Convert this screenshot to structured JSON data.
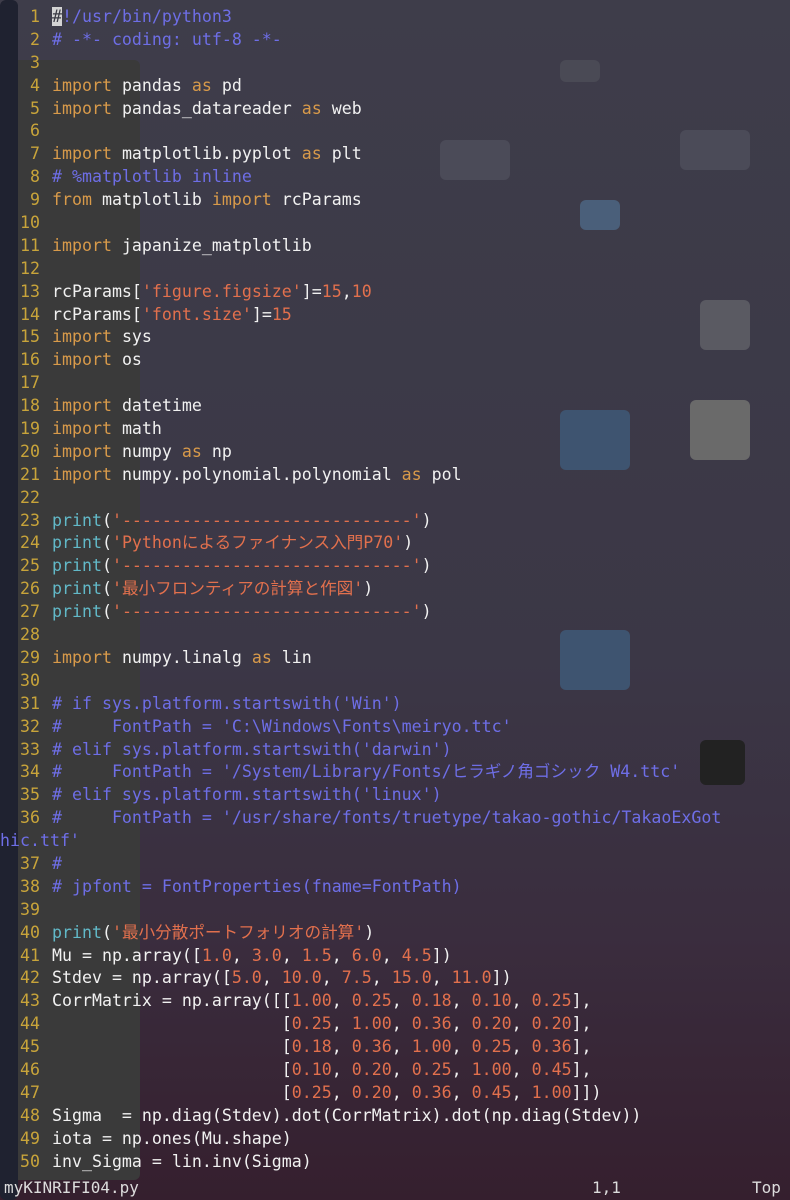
{
  "lines": [
    {
      "n": "1",
      "segs": [
        {
          "t": "#",
          "c": "cur"
        },
        {
          "t": "!/usr/bin/python3",
          "c": "c"
        }
      ]
    },
    {
      "n": "2",
      "segs": [
        {
          "t": "# -*- coding: utf-8 -*-",
          "c": "c"
        }
      ]
    },
    {
      "n": "3",
      "segs": []
    },
    {
      "n": "4",
      "segs": [
        {
          "t": "import",
          "c": "k"
        },
        {
          "t": " pandas ",
          "c": "t"
        },
        {
          "t": "as",
          "c": "k"
        },
        {
          "t": " pd",
          "c": "t"
        }
      ]
    },
    {
      "n": "5",
      "segs": [
        {
          "t": "import",
          "c": "k"
        },
        {
          "t": " pandas_datareader ",
          "c": "t"
        },
        {
          "t": "as",
          "c": "k"
        },
        {
          "t": " web",
          "c": "t"
        }
      ]
    },
    {
      "n": "6",
      "segs": []
    },
    {
      "n": "7",
      "segs": [
        {
          "t": "import",
          "c": "k"
        },
        {
          "t": " matplotlib.pyplot ",
          "c": "t"
        },
        {
          "t": "as",
          "c": "k"
        },
        {
          "t": " plt",
          "c": "t"
        }
      ]
    },
    {
      "n": "8",
      "segs": [
        {
          "t": "# %matplotlib inline",
          "c": "c"
        }
      ]
    },
    {
      "n": "9",
      "segs": [
        {
          "t": "from",
          "c": "k"
        },
        {
          "t": " matplotlib ",
          "c": "t"
        },
        {
          "t": "import",
          "c": "k"
        },
        {
          "t": " rcParams",
          "c": "t"
        }
      ]
    },
    {
      "n": "10",
      "segs": []
    },
    {
      "n": "11",
      "segs": [
        {
          "t": "import",
          "c": "k"
        },
        {
          "t": " japanize_matplotlib",
          "c": "t"
        }
      ]
    },
    {
      "n": "12",
      "segs": []
    },
    {
      "n": "13",
      "segs": [
        {
          "t": "rcParams[",
          "c": "t"
        },
        {
          "t": "'figure.figsize'",
          "c": "s"
        },
        {
          "t": "]=",
          "c": "t"
        },
        {
          "t": "15",
          "c": "n"
        },
        {
          "t": ",",
          "c": "t"
        },
        {
          "t": "10",
          "c": "n"
        }
      ]
    },
    {
      "n": "14",
      "segs": [
        {
          "t": "rcParams[",
          "c": "t"
        },
        {
          "t": "'font.size'",
          "c": "s"
        },
        {
          "t": "]=",
          "c": "t"
        },
        {
          "t": "15",
          "c": "n"
        }
      ]
    },
    {
      "n": "15",
      "segs": [
        {
          "t": "import",
          "c": "k"
        },
        {
          "t": " sys",
          "c": "t"
        }
      ]
    },
    {
      "n": "16",
      "segs": [
        {
          "t": "import",
          "c": "k"
        },
        {
          "t": " os",
          "c": "t"
        }
      ]
    },
    {
      "n": "17",
      "segs": []
    },
    {
      "n": "18",
      "segs": [
        {
          "t": "import",
          "c": "k"
        },
        {
          "t": " datetime",
          "c": "t"
        }
      ]
    },
    {
      "n": "19",
      "segs": [
        {
          "t": "import",
          "c": "k"
        },
        {
          "t": " math",
          "c": "t"
        }
      ]
    },
    {
      "n": "20",
      "segs": [
        {
          "t": "import",
          "c": "k"
        },
        {
          "t": " numpy ",
          "c": "t"
        },
        {
          "t": "as",
          "c": "k"
        },
        {
          "t": " np",
          "c": "t"
        }
      ]
    },
    {
      "n": "21",
      "segs": [
        {
          "t": "import",
          "c": "k"
        },
        {
          "t": " numpy.polynomial.polynomial ",
          "c": "t"
        },
        {
          "t": "as",
          "c": "k"
        },
        {
          "t": " pol",
          "c": "t"
        }
      ]
    },
    {
      "n": "22",
      "segs": []
    },
    {
      "n": "23",
      "segs": [
        {
          "t": "print",
          "c": "f"
        },
        {
          "t": "(",
          "c": "t"
        },
        {
          "t": "'-----------------------------'",
          "c": "s"
        },
        {
          "t": ")",
          "c": "t"
        }
      ]
    },
    {
      "n": "24",
      "segs": [
        {
          "t": "print",
          "c": "f"
        },
        {
          "t": "(",
          "c": "t"
        },
        {
          "t": "'Pythonによるファイナンス入門P70'",
          "c": "s"
        },
        {
          "t": ")",
          "c": "t"
        }
      ]
    },
    {
      "n": "25",
      "segs": [
        {
          "t": "print",
          "c": "f"
        },
        {
          "t": "(",
          "c": "t"
        },
        {
          "t": "'-----------------------------'",
          "c": "s"
        },
        {
          "t": ")",
          "c": "t"
        }
      ]
    },
    {
      "n": "26",
      "segs": [
        {
          "t": "print",
          "c": "f"
        },
        {
          "t": "(",
          "c": "t"
        },
        {
          "t": "'最小フロンティアの計算と作図'",
          "c": "s"
        },
        {
          "t": ")",
          "c": "t"
        }
      ]
    },
    {
      "n": "27",
      "segs": [
        {
          "t": "print",
          "c": "f"
        },
        {
          "t": "(",
          "c": "t"
        },
        {
          "t": "'-----------------------------'",
          "c": "s"
        },
        {
          "t": ")",
          "c": "t"
        }
      ]
    },
    {
      "n": "28",
      "segs": []
    },
    {
      "n": "29",
      "segs": [
        {
          "t": "import",
          "c": "k"
        },
        {
          "t": " numpy.linalg ",
          "c": "t"
        },
        {
          "t": "as",
          "c": "k"
        },
        {
          "t": " lin",
          "c": "t"
        }
      ]
    },
    {
      "n": "30",
      "segs": []
    },
    {
      "n": "31",
      "segs": [
        {
          "t": "# if sys.platform.startswith('Win')",
          "c": "c"
        }
      ]
    },
    {
      "n": "32",
      "segs": [
        {
          "t": "#     FontPath = 'C:\\Windows\\Fonts\\meiryo.ttc'",
          "c": "c"
        }
      ]
    },
    {
      "n": "33",
      "segs": [
        {
          "t": "# elif sys.platform.startswith('darwin')",
          "c": "c"
        }
      ]
    },
    {
      "n": "34",
      "segs": [
        {
          "t": "#     FontPath = '/System/Library/Fonts/ヒラギノ角ゴシック W4.ttc'",
          "c": "c"
        }
      ]
    },
    {
      "n": "35",
      "segs": [
        {
          "t": "# elif sys.platform.startswith('linux')",
          "c": "c"
        }
      ]
    },
    {
      "n": "36",
      "segs": [
        {
          "t": "#     FontPath = '/usr/share/fonts/truetype/takao-gothic/TakaoExGot",
          "c": "c"
        }
      ]
    },
    {
      "n": "",
      "cont": true,
      "segs": [
        {
          "t": "hic.ttf'",
          "c": "c"
        }
      ]
    },
    {
      "n": "37",
      "segs": [
        {
          "t": "#",
          "c": "c"
        }
      ]
    },
    {
      "n": "38",
      "segs": [
        {
          "t": "# jpfont = FontProperties(fname=FontPath)",
          "c": "c"
        }
      ]
    },
    {
      "n": "39",
      "segs": []
    },
    {
      "n": "40",
      "segs": [
        {
          "t": "print",
          "c": "f"
        },
        {
          "t": "(",
          "c": "t"
        },
        {
          "t": "'最小分散ポートフォリオの計算'",
          "c": "s"
        },
        {
          "t": ")",
          "c": "t"
        }
      ]
    },
    {
      "n": "41",
      "segs": [
        {
          "t": "Mu = np.array([",
          "c": "t"
        },
        {
          "t": "1.0",
          "c": "n"
        },
        {
          "t": ", ",
          "c": "t"
        },
        {
          "t": "3.0",
          "c": "n"
        },
        {
          "t": ", ",
          "c": "t"
        },
        {
          "t": "1.5",
          "c": "n"
        },
        {
          "t": ", ",
          "c": "t"
        },
        {
          "t": "6.0",
          "c": "n"
        },
        {
          "t": ", ",
          "c": "t"
        },
        {
          "t": "4.5",
          "c": "n"
        },
        {
          "t": "])",
          "c": "t"
        }
      ]
    },
    {
      "n": "42",
      "segs": [
        {
          "t": "Stdev = np.array([",
          "c": "t"
        },
        {
          "t": "5.0",
          "c": "n"
        },
        {
          "t": ", ",
          "c": "t"
        },
        {
          "t": "10.0",
          "c": "n"
        },
        {
          "t": ", ",
          "c": "t"
        },
        {
          "t": "7.5",
          "c": "n"
        },
        {
          "t": ", ",
          "c": "t"
        },
        {
          "t": "15.0",
          "c": "n"
        },
        {
          "t": ", ",
          "c": "t"
        },
        {
          "t": "11.0",
          "c": "n"
        },
        {
          "t": "])",
          "c": "t"
        }
      ]
    },
    {
      "n": "43",
      "segs": [
        {
          "t": "CorrMatrix = np.array([[",
          "c": "t"
        },
        {
          "t": "1.00",
          "c": "n"
        },
        {
          "t": ", ",
          "c": "t"
        },
        {
          "t": "0.25",
          "c": "n"
        },
        {
          "t": ", ",
          "c": "t"
        },
        {
          "t": "0.18",
          "c": "n"
        },
        {
          "t": ", ",
          "c": "t"
        },
        {
          "t": "0.10",
          "c": "n"
        },
        {
          "t": ", ",
          "c": "t"
        },
        {
          "t": "0.25",
          "c": "n"
        },
        {
          "t": "],",
          "c": "t"
        }
      ]
    },
    {
      "n": "44",
      "segs": [
        {
          "t": "                       [",
          "c": "t"
        },
        {
          "t": "0.25",
          "c": "n"
        },
        {
          "t": ", ",
          "c": "t"
        },
        {
          "t": "1.00",
          "c": "n"
        },
        {
          "t": ", ",
          "c": "t"
        },
        {
          "t": "0.36",
          "c": "n"
        },
        {
          "t": ", ",
          "c": "t"
        },
        {
          "t": "0.20",
          "c": "n"
        },
        {
          "t": ", ",
          "c": "t"
        },
        {
          "t": "0.20",
          "c": "n"
        },
        {
          "t": "],",
          "c": "t"
        }
      ]
    },
    {
      "n": "45",
      "segs": [
        {
          "t": "                       [",
          "c": "t"
        },
        {
          "t": "0.18",
          "c": "n"
        },
        {
          "t": ", ",
          "c": "t"
        },
        {
          "t": "0.36",
          "c": "n"
        },
        {
          "t": ", ",
          "c": "t"
        },
        {
          "t": "1.00",
          "c": "n"
        },
        {
          "t": ", ",
          "c": "t"
        },
        {
          "t": "0.25",
          "c": "n"
        },
        {
          "t": ", ",
          "c": "t"
        },
        {
          "t": "0.36",
          "c": "n"
        },
        {
          "t": "],",
          "c": "t"
        }
      ]
    },
    {
      "n": "46",
      "segs": [
        {
          "t": "                       [",
          "c": "t"
        },
        {
          "t": "0.10",
          "c": "n"
        },
        {
          "t": ", ",
          "c": "t"
        },
        {
          "t": "0.20",
          "c": "n"
        },
        {
          "t": ", ",
          "c": "t"
        },
        {
          "t": "0.25",
          "c": "n"
        },
        {
          "t": ", ",
          "c": "t"
        },
        {
          "t": "1.00",
          "c": "n"
        },
        {
          "t": ", ",
          "c": "t"
        },
        {
          "t": "0.45",
          "c": "n"
        },
        {
          "t": "],",
          "c": "t"
        }
      ]
    },
    {
      "n": "47",
      "segs": [
        {
          "t": "                       [",
          "c": "t"
        },
        {
          "t": "0.25",
          "c": "n"
        },
        {
          "t": ", ",
          "c": "t"
        },
        {
          "t": "0.20",
          "c": "n"
        },
        {
          "t": ", ",
          "c": "t"
        },
        {
          "t": "0.36",
          "c": "n"
        },
        {
          "t": ", ",
          "c": "t"
        },
        {
          "t": "0.45",
          "c": "n"
        },
        {
          "t": ", ",
          "c": "t"
        },
        {
          "t": "1.00",
          "c": "n"
        },
        {
          "t": "]])",
          "c": "t"
        }
      ]
    },
    {
      "n": "48",
      "segs": [
        {
          "t": "Sigma  = np.diag(Stdev).dot(CorrMatrix).dot(np.diag(Stdev))",
          "c": "t"
        }
      ]
    },
    {
      "n": "49",
      "segs": [
        {
          "t": "iota = np.ones(Mu.shape)",
          "c": "t"
        }
      ]
    },
    {
      "n": "50",
      "segs": [
        {
          "t": "inv_Sigma = lin.inv(Sigma)",
          "c": "t"
        }
      ]
    }
  ],
  "status": {
    "filename": "myKINRIFI04.py",
    "position": "1,1",
    "scroll": "Top"
  }
}
